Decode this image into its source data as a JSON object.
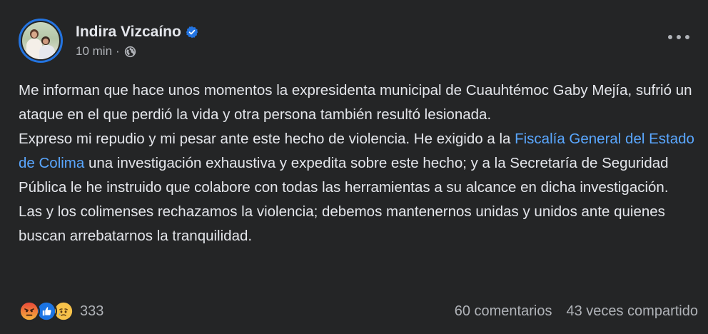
{
  "post": {
    "author": "Indira Vizcaíno",
    "time": "10 min",
    "separator": "·",
    "icons": {
      "verified": "verified-badge-icon",
      "audience": "globe-icon",
      "menu": "more-options-icon"
    },
    "body": {
      "p1": "Me informan que hace unos momentos la expresidenta municipal de Cuauhtémoc Gaby Mejía, sufrió un ataque en el que perdió la vida y otra persona también resultó lesionada.",
      "p2_before": "Expreso mi repudio y mi pesar ante este hecho de violencia. He exigido a la ",
      "p2_link": "Fiscalía General del Estado de Colima",
      "p2_after": " una investigación exhaustiva y expedita sobre este hecho; y a la Secretaría de Seguridad Pública le he instruido que colabore con todas las herramientas a su alcance en dicha investigación.",
      "p3": "Las y los colimenses rechazamos la violencia; debemos mantenernos unidas y unidos ante quienes buscan arrebatarnos la tranquilidad."
    },
    "reactions": {
      "icons": [
        "angry-reaction-icon",
        "like-reaction-icon",
        "sad-reaction-icon"
      ],
      "count": "333"
    },
    "comments": "60 comentarios",
    "shares": "43 veces compartido"
  },
  "colors": {
    "background": "#242526",
    "text": "#e4e6eb",
    "secondary_text": "#b0b3b8",
    "link": "#5aa7ff",
    "verified": "#2374e1"
  }
}
